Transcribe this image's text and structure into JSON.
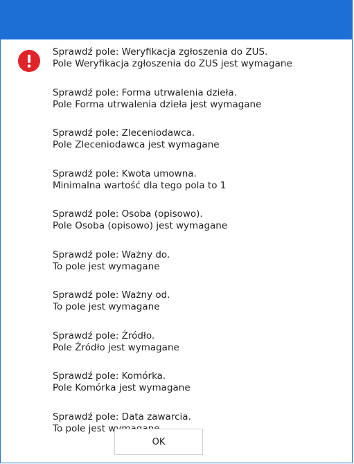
{
  "dialog": {
    "icon": "error-exclamation-icon",
    "accent_color": "#1d6fd6",
    "error_color": "#e0242a",
    "messages": [
      {
        "line1": "Sprawdź pole: Weryfikacja zgłoszenia do ZUS.",
        "line2": "Pole Weryfikacja zgłoszenia do ZUS jest wymagane"
      },
      {
        "line1": "Sprawdź pole: Forma utrwalenia dzieła.",
        "line2": "Pole Forma utrwalenia dzieła jest wymagane"
      },
      {
        "line1": "Sprawdź pole: Zleceniodawca.",
        "line2": "Pole Zleceniodawca jest wymagane"
      },
      {
        "line1": "Sprawdź pole: Kwota umowna.",
        "line2": "Minimalna wartość dla tego pola to 1"
      },
      {
        "line1": "Sprawdź pole: Osoba (opisowo).",
        "line2": "Pole Osoba (opisowo) jest wymagane"
      },
      {
        "line1": "Sprawdź pole: Ważny do.",
        "line2": "To pole jest wymagane"
      },
      {
        "line1": "Sprawdź pole: Ważny od.",
        "line2": "To pole jest wymagane"
      },
      {
        "line1": "Sprawdź pole: Źródło.",
        "line2": "Pole Źródło jest wymagane"
      },
      {
        "line1": "Sprawdź pole: Komórka.",
        "line2": "Pole Komórka jest wymagane"
      },
      {
        "line1": "Sprawdź pole: Data zawarcia.",
        "line2": "To pole jest wymagane"
      }
    ],
    "ok_label": "OK"
  }
}
